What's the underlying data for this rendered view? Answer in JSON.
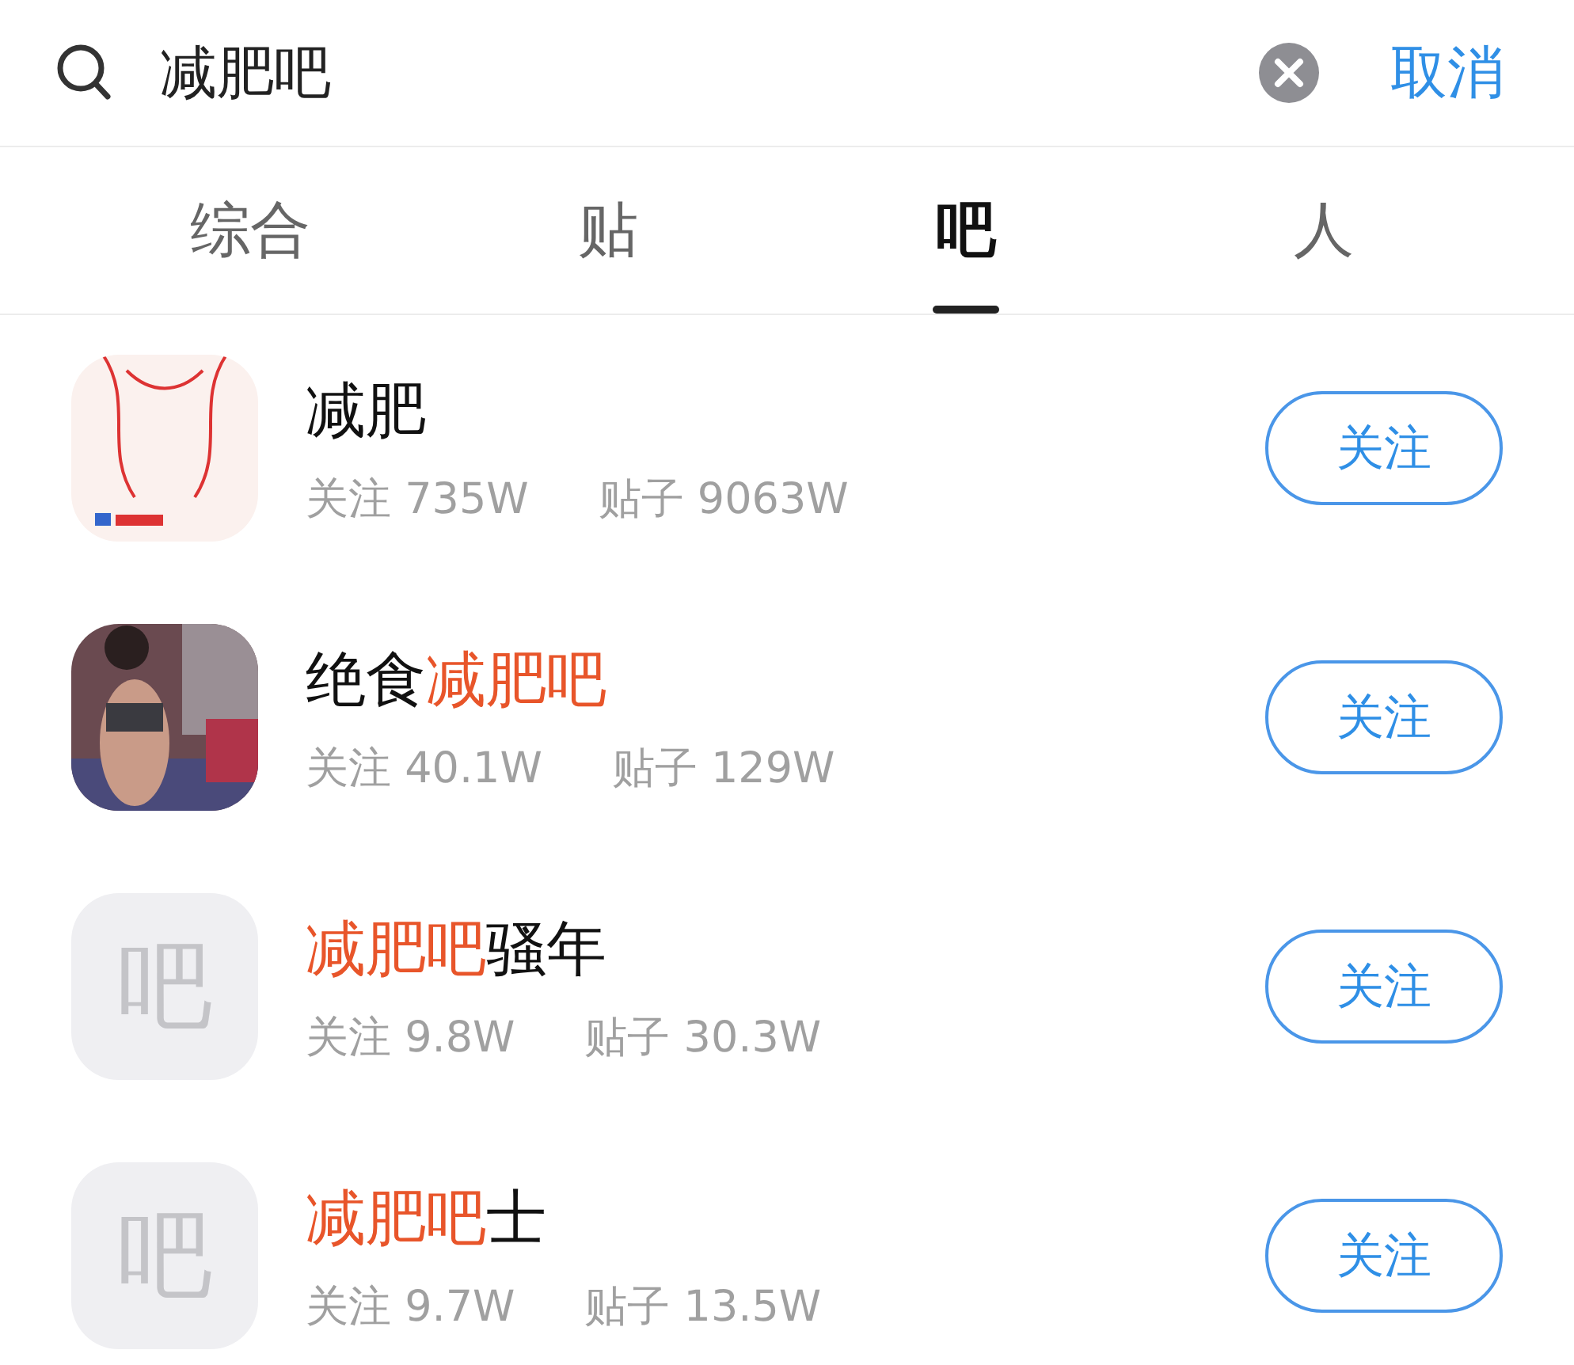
{
  "search": {
    "value": "减肥吧",
    "cancel": "取消"
  },
  "tabs": [
    {
      "label": "综合",
      "selected": false
    },
    {
      "label": "贴",
      "selected": false
    },
    {
      "label": "吧",
      "selected": true
    },
    {
      "label": "人",
      "selected": false
    }
  ],
  "results": [
    {
      "avatar": {
        "kind": "picture"
      },
      "name": [
        {
          "text": "减肥",
          "highlight": false
        }
      ],
      "followers_label": "关注",
      "followers": "735W",
      "posts_label": "贴子",
      "posts": "9063W",
      "button": "关注"
    },
    {
      "avatar": {
        "kind": "picture"
      },
      "name": [
        {
          "text": "绝食",
          "highlight": false
        },
        {
          "text": "减肥吧",
          "highlight": true
        }
      ],
      "followers_label": "关注",
      "followers": "40.1W",
      "posts_label": "贴子",
      "posts": "129W",
      "button": "关注"
    },
    {
      "avatar": {
        "kind": "placeholder",
        "text": "吧"
      },
      "name": [
        {
          "text": "减肥吧",
          "highlight": true
        },
        {
          "text": "骚年",
          "highlight": false
        }
      ],
      "followers_label": "关注",
      "followers": "9.8W",
      "posts_label": "贴子",
      "posts": "30.3W",
      "button": "关注"
    },
    {
      "avatar": {
        "kind": "placeholder",
        "text": "吧"
      },
      "name": [
        {
          "text": "减肥吧",
          "highlight": true
        },
        {
          "text": "士",
          "highlight": false
        }
      ],
      "followers_label": "关注",
      "followers": "9.7W",
      "posts_label": "贴子",
      "posts": "13.5W",
      "button": "关注"
    }
  ]
}
